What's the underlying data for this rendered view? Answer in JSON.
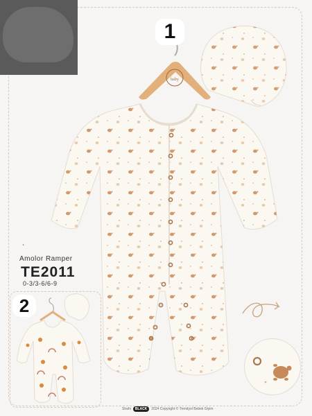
{
  "product": {
    "badge_main": "1",
    "badge_thumb": "2",
    "tick": "`",
    "name": "Amolor Ramper",
    "code": "TE2011",
    "sizes": "0-3/3-6/6-9"
  },
  "footer": {
    "brand_prefix": "Shahi",
    "badge": "BLACK",
    "copyright": "2024 Copyright © Trendyol Bebek Giyim"
  },
  "colors": {
    "background": "#f6f5f3",
    "fabric": "#fbf8f1",
    "print": "#c8895a",
    "hanger": "#e2b07a",
    "snap": "#a8794e"
  }
}
